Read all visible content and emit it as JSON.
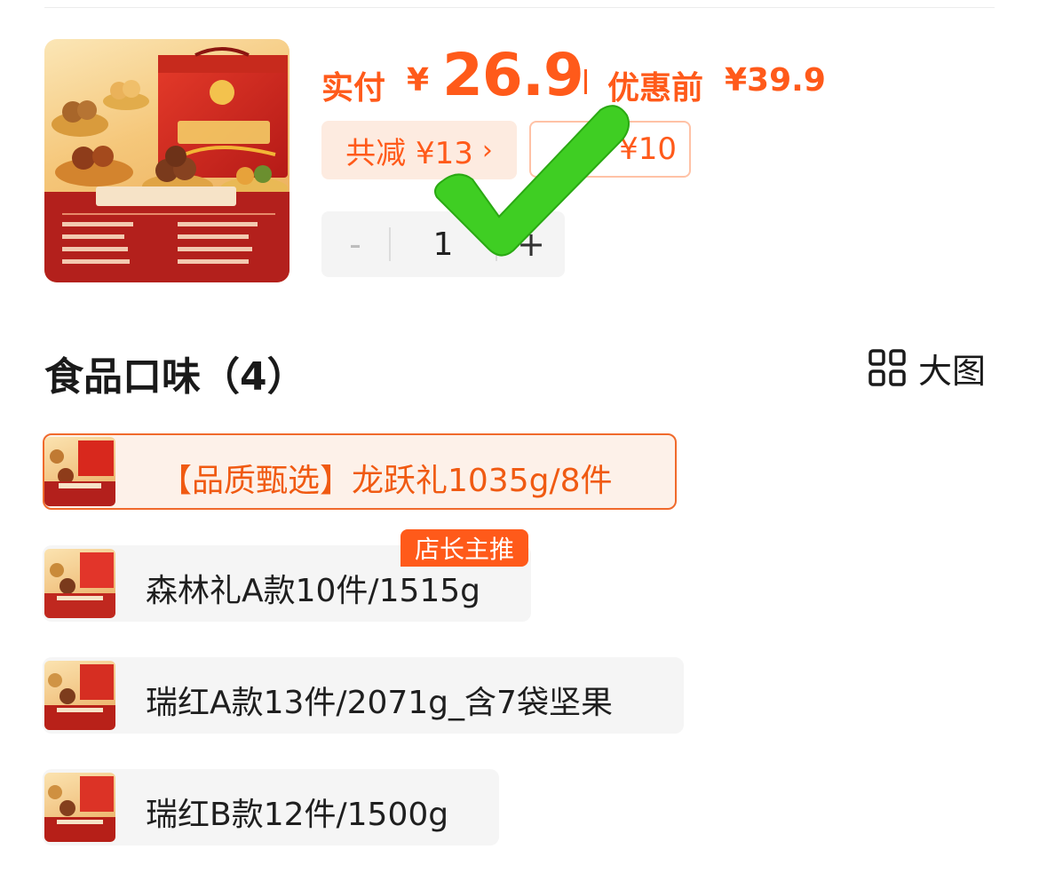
{
  "product": {
    "paid_label": "实付",
    "currency": "¥",
    "paid_price": "26.9",
    "before_label": "优惠前",
    "before_price": "¥39.9",
    "discount_chip": "共减 ¥13",
    "discount_chevron": "›",
    "coupon_chip": "¥10",
    "quantity": {
      "minus": "-",
      "value": "1",
      "plus": "+"
    }
  },
  "section": {
    "title": "食品口味（4）",
    "view_toggle_label": "大图"
  },
  "flavors": [
    {
      "label": "【品质甄选】龙跃礼1035g/8件",
      "selected": true
    },
    {
      "label": "森林礼A款10件/1515g",
      "selected": false,
      "badge": "店长主推"
    },
    {
      "label": "瑞红A款13件/2071g_含7袋坚果",
      "selected": false
    },
    {
      "label": "瑞红B款12件/1500g",
      "selected": false
    }
  ],
  "colors": {
    "accent": "#ff5a1a",
    "selected_border": "#f06a2c",
    "chip_bg": "#fdebe0",
    "option_bg": "#f5f5f5",
    "checkmark": "#3fce23"
  },
  "icons": {
    "view_toggle": "grid-icon",
    "overlay": "checkmark-icon"
  }
}
